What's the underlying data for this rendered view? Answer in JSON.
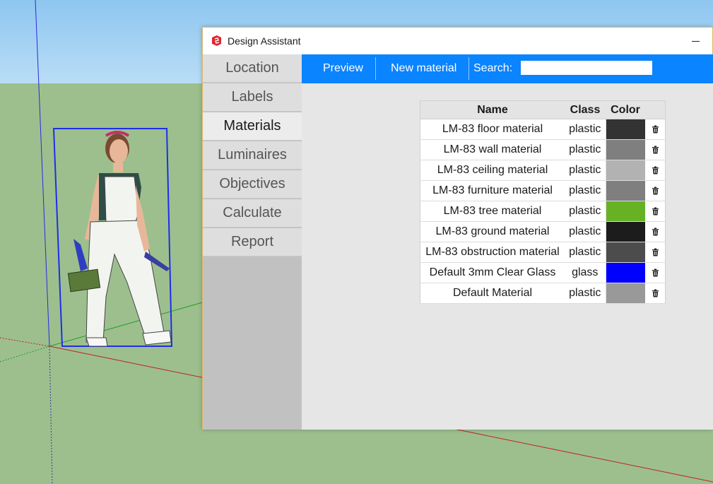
{
  "window": {
    "title": "Design Assistant"
  },
  "sidebar": {
    "tabs": [
      {
        "label": "Location",
        "active": false
      },
      {
        "label": "Labels",
        "active": false
      },
      {
        "label": "Materials",
        "active": true
      },
      {
        "label": "Luminaires",
        "active": false
      },
      {
        "label": "Objectives",
        "active": false
      },
      {
        "label": "Calculate",
        "active": false
      },
      {
        "label": "Report",
        "active": false
      }
    ]
  },
  "toolbar": {
    "preview_label": "Preview",
    "new_material_label": "New material",
    "search_label": "Search:",
    "search_value": ""
  },
  "materials_table": {
    "headers": {
      "name": "Name",
      "class": "Class",
      "color": "Color"
    },
    "rows": [
      {
        "name": "LM-83 floor material",
        "class": "plastic",
        "color": "#333333"
      },
      {
        "name": "LM-83 wall material",
        "class": "plastic",
        "color": "#7f7f7f"
      },
      {
        "name": "LM-83 ceiling material",
        "class": "plastic",
        "color": "#b2b2b2"
      },
      {
        "name": "LM-83 furniture material",
        "class": "plastic",
        "color": "#7f7f7f"
      },
      {
        "name": "LM-83 tree material",
        "class": "plastic",
        "color": "#66b224"
      },
      {
        "name": "LM-83 ground material",
        "class": "plastic",
        "color": "#1c1c1c"
      },
      {
        "name": "LM-83 obstruction material",
        "class": "plastic",
        "color": "#4c4c4c"
      },
      {
        "name": "Default 3mm Clear Glass",
        "class": "glass",
        "color": "#0000ff"
      },
      {
        "name": "Default Material",
        "class": "plastic",
        "color": "#999999"
      }
    ]
  },
  "icons": {
    "app": "sketchup-icon",
    "delete": "trash-icon",
    "minimize": "minimize-icon"
  },
  "colors": {
    "accent": "#0a84ff",
    "sky": "#8ec6f0",
    "ground": "#9dbf8e"
  }
}
